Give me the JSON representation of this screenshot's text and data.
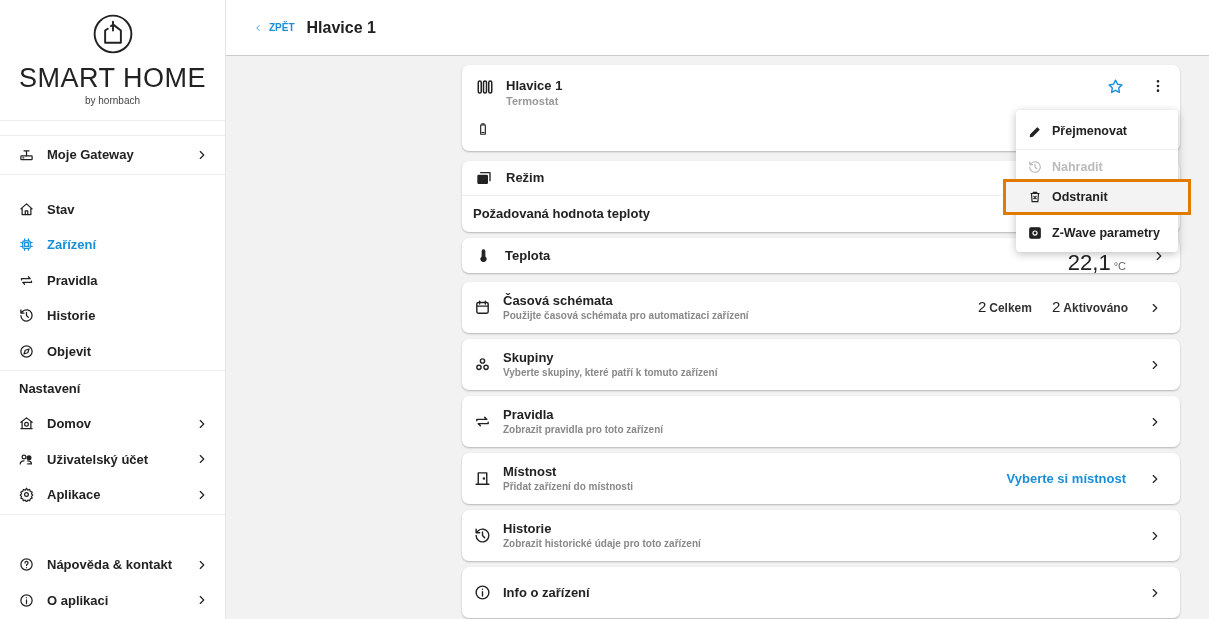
{
  "sidebar": {
    "logo": {
      "title": "SMART HOME",
      "subtitle": "by hornbach"
    },
    "gateway": {
      "label": "Moje Gateway"
    },
    "nav": [
      {
        "label": "Stav",
        "selected": false
      },
      {
        "label": "Zařízení",
        "selected": true
      },
      {
        "label": "Pravidla",
        "selected": false
      },
      {
        "label": "Historie",
        "selected": false
      },
      {
        "label": "Objevit",
        "selected": false
      }
    ],
    "settings": {
      "title": "Nastavení",
      "items": [
        {
          "label": "Domov"
        },
        {
          "label": "Uživatelský účet"
        },
        {
          "label": "Aplikace"
        }
      ]
    },
    "footer": [
      {
        "label": "Nápověda & kontakt"
      },
      {
        "label": "O aplikaci"
      }
    ]
  },
  "header": {
    "back": "ZPĚT",
    "title": "Hlavice 1"
  },
  "device": {
    "name": "Hlavice 1",
    "type": "Termostat",
    "favorite": false
  },
  "menu": [
    {
      "label": "Přejmenovat",
      "disabled": false,
      "highlighted": false
    },
    {
      "label": "Nahradit",
      "disabled": true,
      "highlighted": false
    },
    {
      "label": "Odstranit",
      "disabled": false,
      "highlighted": true
    },
    {
      "label": "Z-Wave parametry",
      "disabled": false,
      "highlighted": false
    }
  ],
  "mode": {
    "title": "Režim",
    "setpoint_label": "Požadovaná hodnota teploty"
  },
  "temperature": {
    "label": "Teplota",
    "value": "22,1",
    "unit": "°C"
  },
  "rows": [
    {
      "title": "Časová schémata",
      "subtitle": "Použijte časová schémata pro automatizaci zařízení",
      "stats": [
        {
          "count": "2",
          "label": "Celkem"
        },
        {
          "count": "2",
          "label": "Aktivováno"
        }
      ]
    },
    {
      "title": "Skupiny",
      "subtitle": "Vyberte skupiny, které patří k tomuto zařízení"
    },
    {
      "title": "Pravidla",
      "subtitle": "Zobrazit pravidla pro toto zařízení"
    },
    {
      "title": "Místnost",
      "subtitle": "Přidat zařízení do místnosti",
      "action": "Vyberte si místnost"
    },
    {
      "title": "Historie",
      "subtitle": "Zobrazit historické údaje pro toto zařízení"
    },
    {
      "title": "Info o zařízení"
    }
  ]
}
